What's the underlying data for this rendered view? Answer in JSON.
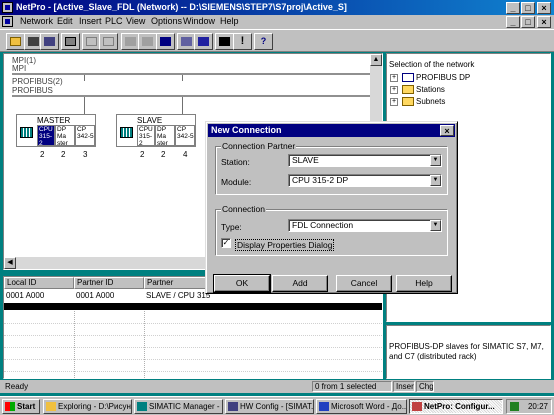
{
  "window": {
    "title": "NetPro - [Active_Slave_FDL (Network) -- D:\\SIEMENS\\STEP7\\S7proj\\Active_S]",
    "controls": [
      "_",
      "□",
      "×"
    ]
  },
  "menubar": {
    "items": [
      "Network",
      "Edit",
      "Insert",
      "PLC",
      "View",
      "Options",
      "Window",
      "Help"
    ]
  },
  "toolbar": {
    "buttons": [
      "open-icon",
      "save-icon",
      "save-compile-icon",
      "print-icon",
      "copy-icon",
      "paste-icon",
      "download-icon",
      "upload-icon",
      "find-icon",
      "properties-icon",
      "config-icon",
      "net-icon",
      "warning-icon",
      "help-icon"
    ]
  },
  "network": {
    "mpi_label1": "MPI(1)",
    "mpi_label2": "MPI",
    "profibus_label1": "PROFIBUS(2)",
    "profibus_label2": "PROFIBUS",
    "stations": [
      {
        "name": "MASTER",
        "modules": [
          "CPU 315-2",
          "DP Ma ster",
          "CP 342-5"
        ],
        "slots": [
          "2",
          "2",
          "3"
        ]
      },
      {
        "name": "SLAVE",
        "modules": [
          "CPU 315-2",
          "DP Ma ster",
          "CP 342-5"
        ],
        "slots": [
          "2",
          "2",
          "4"
        ]
      }
    ]
  },
  "connection_table": {
    "columns": [
      "Local ID",
      "Partner ID",
      "Partner"
    ],
    "rows": [
      {
        "local_id": "0001 A000",
        "partner_id": "0001 A000",
        "partner": "SLAVE / CPU 315"
      }
    ]
  },
  "right_panel": {
    "header": "Selection of the network",
    "tree": [
      {
        "label": "PROFIBUS DP",
        "expander": "+"
      },
      {
        "label": "Stations",
        "expander": "+"
      },
      {
        "label": "Subnets",
        "expander": "+"
      }
    ],
    "info": "PROFIBUS-DP slaves for SIMATIC S7, M7, and C7 (distributed rack)"
  },
  "statusbar": {
    "ready": "Ready",
    "selection": "0 from 1 selected",
    "mode1": "Insert",
    "mode2": "Chg"
  },
  "dialog": {
    "title": "New Connection",
    "partner_group": "Connection Partner",
    "station_label": "Station:",
    "station_value": "SLAVE",
    "module_label": "Module:",
    "module_value": "CPU 315-2 DP",
    "connection_group": "Connection",
    "type_label": "Type:",
    "type_value": "FDL Connection",
    "checkbox_label": "Display Properties Dialog",
    "checkbox_checked": true,
    "buttons": {
      "ok": "OK",
      "add": "Add",
      "cancel": "Cancel",
      "help": "Help"
    }
  },
  "taskbar": {
    "start": "Start",
    "tasks": [
      {
        "label": "Exploring - D:\\Рисун...",
        "active": false
      },
      {
        "label": "SIMATIC Manager - ...",
        "active": false
      },
      {
        "label": "HW Config - [SIMAT...",
        "active": false
      },
      {
        "label": "Microsoft Word - До...",
        "active": false
      },
      {
        "label": "NetPro: Configur...",
        "active": true
      }
    ],
    "clock": "20:27"
  },
  "colors": {
    "titlebar": "#000080",
    "desktop": "#008080",
    "selection": "#000080"
  }
}
